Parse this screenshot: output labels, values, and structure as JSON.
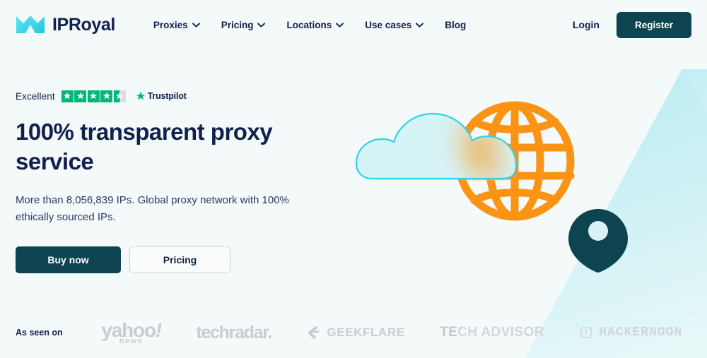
{
  "brand": {
    "name": "IPRoyal",
    "logo_icon": "crown-icon",
    "logo_color": "#35d7e8",
    "text_color": "#11204d"
  },
  "nav": {
    "items": [
      {
        "label": "Proxies",
        "has_dropdown": true,
        "icon": "chevron-down-icon"
      },
      {
        "label": "Pricing",
        "has_dropdown": true,
        "icon": "chevron-down-icon"
      },
      {
        "label": "Locations",
        "has_dropdown": true,
        "icon": "chevron-down-icon"
      },
      {
        "label": "Use cases",
        "has_dropdown": true,
        "icon": "chevron-down-icon"
      },
      {
        "label": "Blog",
        "has_dropdown": false,
        "icon": ""
      }
    ],
    "login_label": "Login",
    "register_label": "Register",
    "register_bg": "#0d4450"
  },
  "hero": {
    "trustpilot": {
      "rating_word": "Excellent",
      "stars_total": 5,
      "stars_filled": 4,
      "half_star": true,
      "star_color": "#00b67a",
      "star_empty_color": "#dcdce6",
      "brand_label": "Trustpilot",
      "brand_icon": "trustpilot-star-icon"
    },
    "headline": "100% transparent proxy service",
    "subhead": "More than 8,056,839 IPs. Global proxy network with 100% ethically sourced IPs.",
    "primary_cta": "Buy now",
    "secondary_cta": "Pricing"
  },
  "illustration": {
    "globe_icon": "globe-icon",
    "globe_color": "#fb9415",
    "cloud_icon": "cloud-icon",
    "cloud_stroke": "#2fd3e8",
    "cloud_fill": "#d4f2f5",
    "pin_icon": "map-pin-icon",
    "pin_color": "#0d4450",
    "mountain_icon": "triangle-icon",
    "mountain_color": "#bfecf3"
  },
  "as_seen_on": {
    "label": "As seen on",
    "logos": [
      {
        "name": "yahoo-news-logo",
        "main": "yahoo",
        "accent": "!",
        "sub": "news"
      },
      {
        "name": "techradar-logo",
        "main": "techradar."
      },
      {
        "name": "geekflare-logo",
        "main": "GEEKFLARE",
        "icon": "geekflare-icon"
      },
      {
        "name": "tech-advisor-logo",
        "bold": "TE",
        "main": "CH ADVISOR"
      },
      {
        "name": "hackernoon-logo",
        "main": "HACKERNOON",
        "icon": "hackernoon-icon"
      }
    ]
  },
  "colors": {
    "page_bg": "#f4f9f9",
    "navy": "#11204d",
    "teal": "#0d4450",
    "orange": "#fb9415",
    "cyan": "#2fd3e8"
  }
}
